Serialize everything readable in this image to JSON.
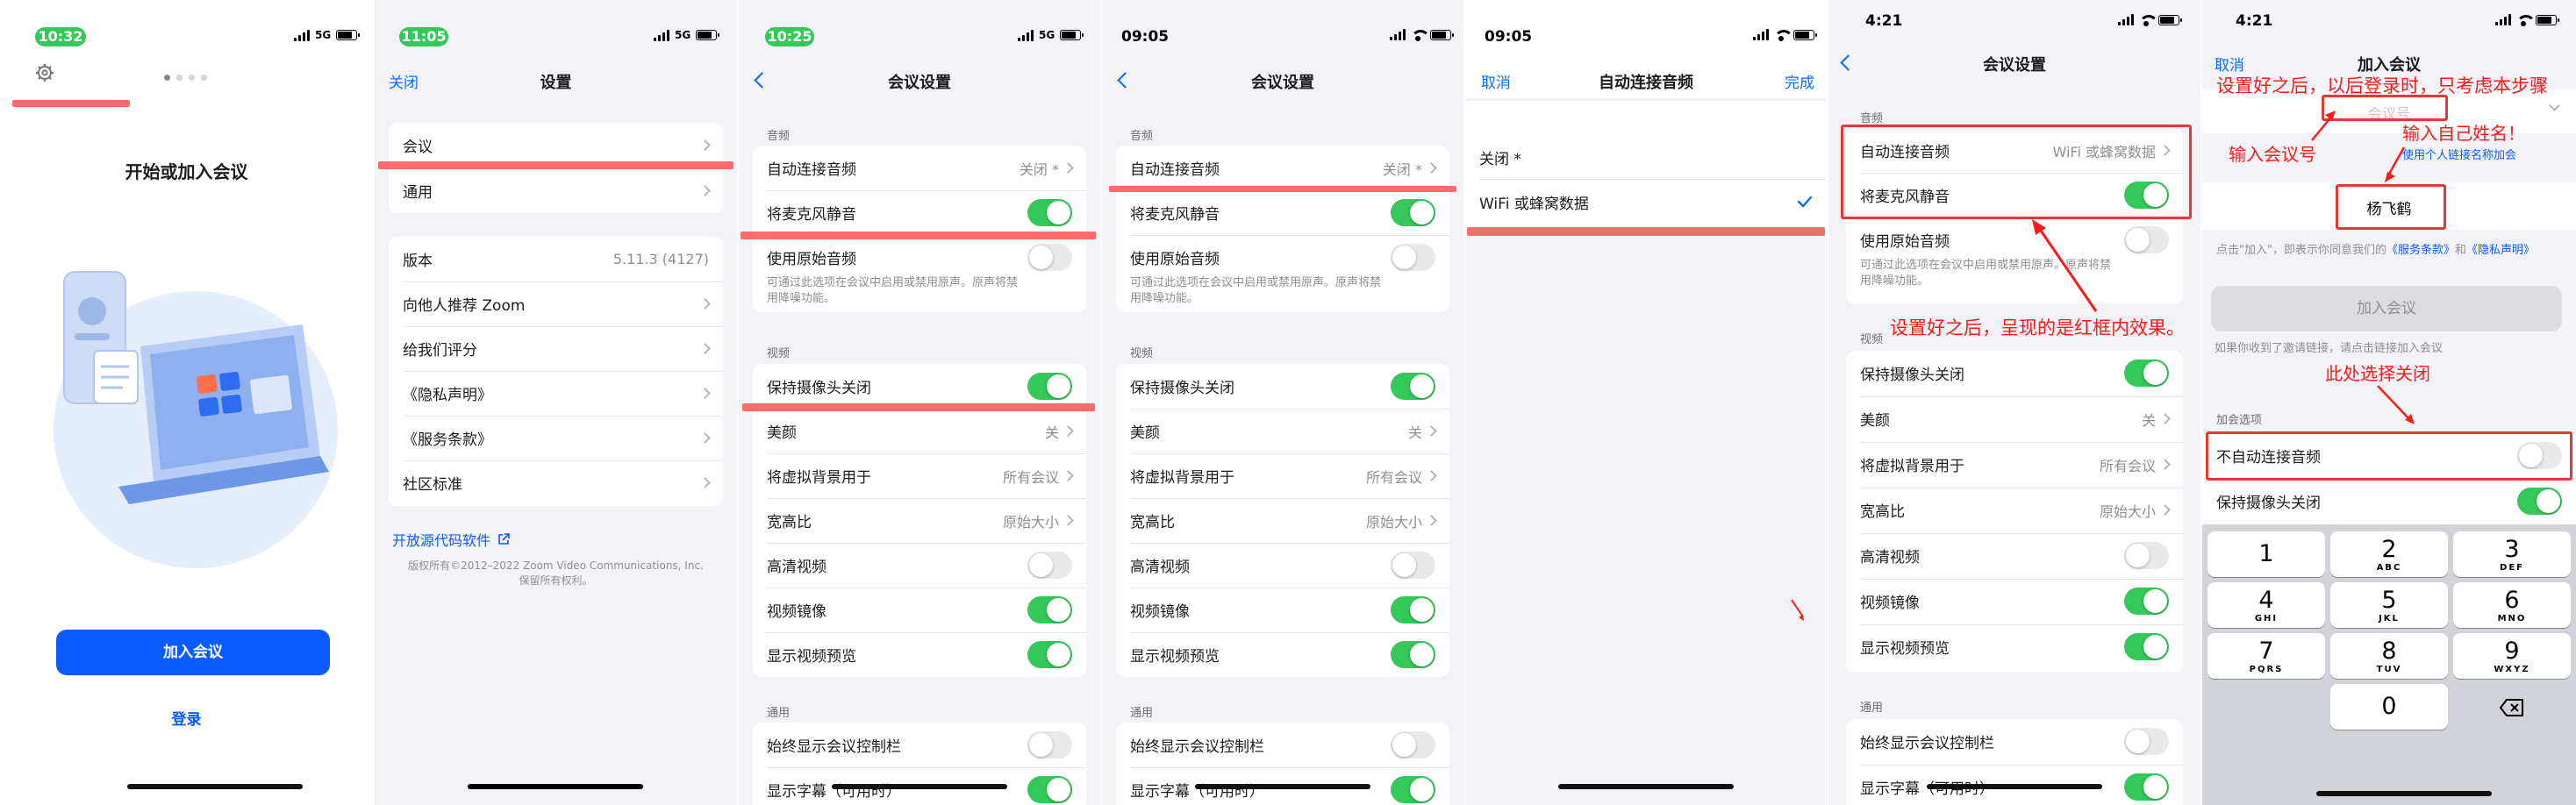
{
  "colors": {
    "accent": "#0a6cff",
    "toggle_on": "#34c759",
    "annotation": "#ff1a1a"
  },
  "p1": {
    "time": "10:32",
    "net": "5G",
    "title": "开始或加入会议",
    "join": "加入会议",
    "login": "登录",
    "icons": [
      "gear-icon",
      "laptop-illustration"
    ]
  },
  "p2": {
    "time": "11:05",
    "net": "5G",
    "close": "关闭",
    "title": "设置",
    "group1": [
      "会议",
      "通用"
    ],
    "version_label": "版本",
    "version_value": "5.11.3 (4127)",
    "group2": [
      "向他人推荐 Zoom",
      "给我们评分",
      "《隐私声明》",
      "《服务条款》",
      "社区标准"
    ],
    "oss": "开放源代码软件",
    "copyright1": "版权所有©2012–2022 Zoom Video Communications, Inc.",
    "copyright2": "保留所有权利。"
  },
  "p3": {
    "time": "10:25",
    "net": "5G",
    "title": "会议设置"
  },
  "p4": {
    "time": "09:05",
    "title": "会议设置"
  },
  "meeting": {
    "sec_audio": "音频",
    "auto_audio": "自动连接音频",
    "auto_audio_val": "关闭 *",
    "mute": "将麦克风静音",
    "orig": "使用原始音频",
    "orig_desc1": "可通过此选项在会议中启用或禁用原声。原声将禁",
    "orig_desc2": "用降噪功能。",
    "sec_video": "视频",
    "keep_cam": "保持摄像头关闭",
    "beauty": "美颜",
    "beauty_val": "关",
    "vbg": "将虚拟背景用于",
    "vbg_val": "所有会议",
    "ratio": "宽高比",
    "ratio_val": "原始大小",
    "hd": "高清视频",
    "mirror": "视频镜像",
    "preview": "显示视频预览",
    "sec_general": "通用",
    "always_bar": "始终显示会议控制栏",
    "subtitle": "显示字幕（可用时）"
  },
  "p5": {
    "time": "09:05",
    "cancel": "取消",
    "title": "自动连接音频",
    "done": "完成",
    "opt1": "关闭 *",
    "opt2": "WiFi 或蜂窝数据"
  },
  "p6": {
    "time": "4:21",
    "title": "会议设置",
    "auto_val": "WiFi 或蜂窝数据",
    "orig_desc1": "可通过此选项在会议中启用或禁用原声。原声将禁",
    "orig_desc2": "用降噪功能。",
    "anno": "设置好之后，呈现的是红框内效果。"
  },
  "p7": {
    "time": "4:21",
    "cancel": "取消",
    "title": "加入会议",
    "id_placeholder": "会议号",
    "link_text": "使用个人链接名称加会",
    "name": "杨飞鹤",
    "terms_a": "点击\"加入\"，即表示你同意我们的",
    "terms_b": "《服务条款》",
    "terms_c": "和",
    "terms_d": "《隐私声",
    "terms_e": "明》",
    "join": "加入会议",
    "invite": "如果你收到了邀请链接，请点击链接加入会议",
    "sec": "加会选项",
    "no_auto": "不自动连接音频",
    "keep_cam": "保持摄像头关闭",
    "anno_top": "设置好之后，以后登录时，只考虑本步骤",
    "anno_id": "输入会议号",
    "anno_name": "输入自己姓名！",
    "anno_close": "此处选择关闭",
    "keys": [
      {
        "n": "1",
        "l": ""
      },
      {
        "n": "2",
        "l": "ABC"
      },
      {
        "n": "3",
        "l": "DEF"
      },
      {
        "n": "4",
        "l": "GHI"
      },
      {
        "n": "5",
        "l": "JKL"
      },
      {
        "n": "6",
        "l": "MNO"
      },
      {
        "n": "7",
        "l": "PQRS"
      },
      {
        "n": "8",
        "l": "TUV"
      },
      {
        "n": "9",
        "l": "WXYZ"
      },
      {
        "n": "0",
        "l": ""
      }
    ]
  }
}
